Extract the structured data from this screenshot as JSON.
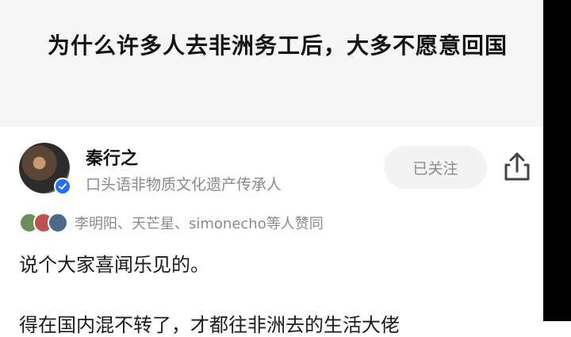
{
  "question": {
    "title": "为什么许多人去非洲务工后，大多不愿意回国"
  },
  "answer": {
    "author_name": "秦行之",
    "author_tagline": "口头语非物质文化遗产传承人",
    "follow_label": "已关注",
    "upvoters_text": "李明阳、天芒星、simonecho等人赞同",
    "body_line1": "说个大家喜闻乐见的。",
    "body_line2": "得在国内混不转了，才都往非洲去的生活大佬"
  },
  "icons": {
    "share": "share-icon",
    "verified": "verified-badge-icon"
  },
  "colors": {
    "header_bg": "#f6f6f6",
    "muted_text": "#8a8a8a",
    "verified_blue": "#1e6fff",
    "follow_bg": "#f3f3f3"
  }
}
